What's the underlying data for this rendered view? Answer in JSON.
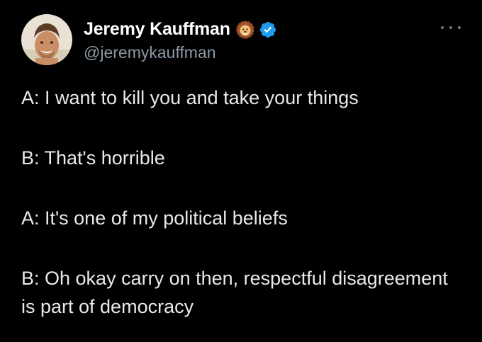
{
  "author": {
    "display_name": "Jeremy Kauffman",
    "handle": "@jeremykauffman",
    "badge_icon": "lion-emoji-icon",
    "verified_icon": "verified-badge-icon",
    "verified_color": "#1d9bf0"
  },
  "menu": {
    "icon": "more-options-icon"
  },
  "tweet": {
    "lines": [
      "A: I want to kill you and take your things",
      "B: That's horrible",
      "A: It's one of my political beliefs",
      "B: Oh okay carry on then, respectful disagreement is part of democracy"
    ]
  },
  "colors": {
    "background": "#000000",
    "text": "#e7e9ea",
    "secondary_text": "#8b98a5"
  }
}
